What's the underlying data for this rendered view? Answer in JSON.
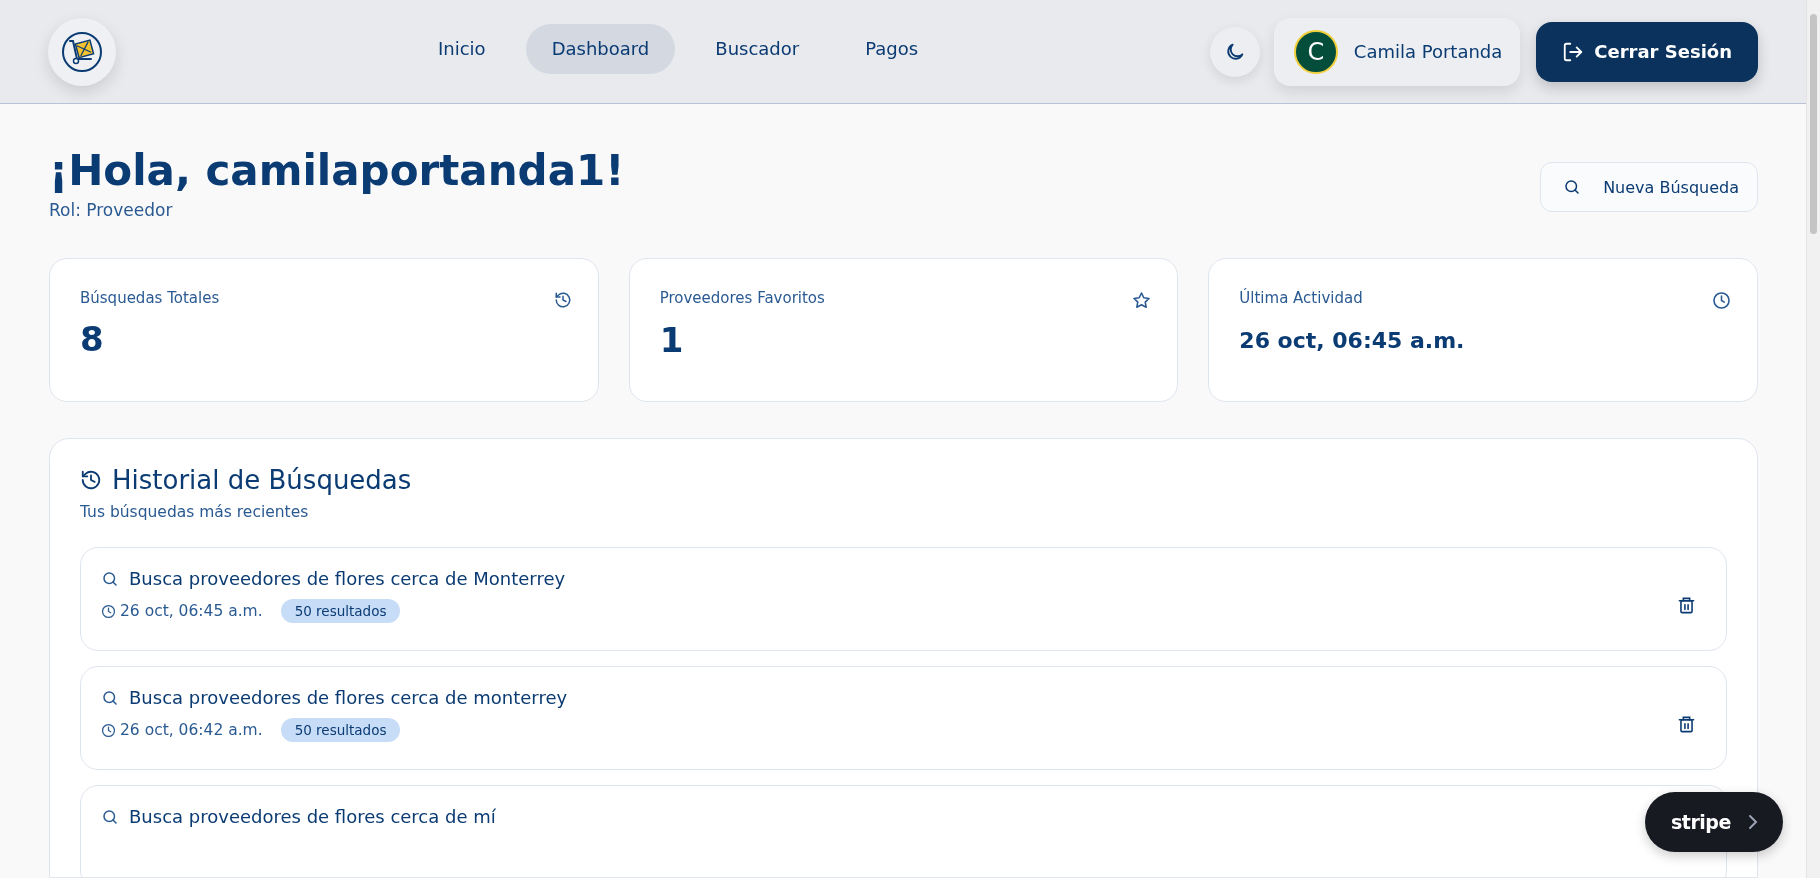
{
  "header": {
    "nav": [
      {
        "label": "Inicio",
        "selected": false
      },
      {
        "label": "Dashboard",
        "selected": true
      },
      {
        "label": "Buscador",
        "selected": false
      },
      {
        "label": "Pagos",
        "selected": false
      }
    ],
    "user": {
      "initial": "C",
      "name": "Camila Portanda"
    },
    "logout": "Cerrar Sesión"
  },
  "greeting": {
    "title": "¡Hola, camilaportanda1!",
    "role": "Rol: Proveedor",
    "new_search": "Nueva Búsqueda"
  },
  "stats": [
    {
      "label": "Búsquedas Totales",
      "value": "8",
      "kind": "history"
    },
    {
      "label": "Proveedores Favoritos",
      "value": "1",
      "kind": "star"
    },
    {
      "label": "Última Actividad",
      "value": "26 oct, 06:45 a.m.",
      "kind": "clock"
    }
  ],
  "history": {
    "title": "Historial de Búsquedas",
    "subtitle": "Tus búsquedas más recientes",
    "items": [
      {
        "query": "Busca proveedores de flores cerca de Monterrey",
        "date": "26 oct, 06:45 a.m.",
        "results": "50 resultados"
      },
      {
        "query": "Busca proveedores de flores cerca de monterrey",
        "date": "26 oct, 06:42 a.m.",
        "results": "50 resultados"
      },
      {
        "query": "Busca proveedores de flores cerca de mí"
      }
    ]
  },
  "stripe_badge": "stripe"
}
